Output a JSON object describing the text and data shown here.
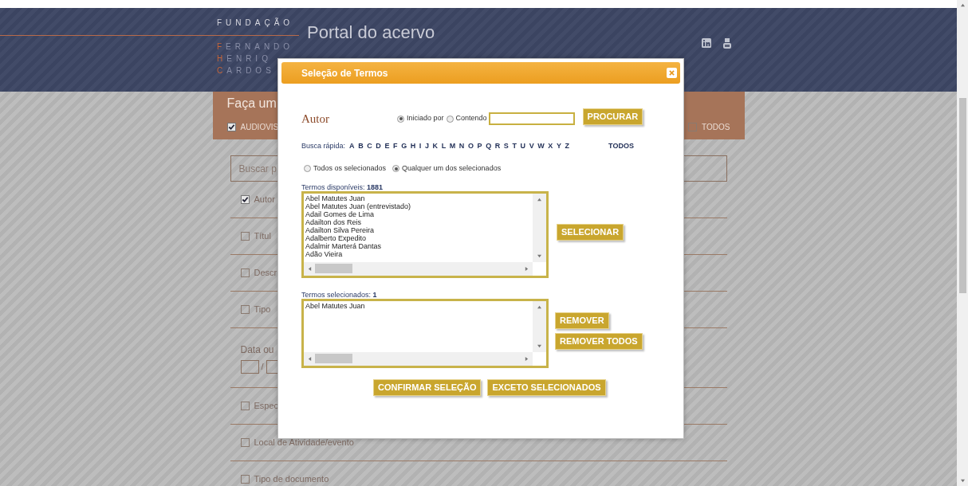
{
  "header": {
    "logo_top": "FUNDAÇÃO",
    "logo_names": [
      "FERNANDO",
      "HENRIQ",
      "CARDOS"
    ],
    "title": "Portal do acervo"
  },
  "search_panel": {
    "title": "Faça um",
    "filters": [
      {
        "label": "AUDIOVIS",
        "checked": true
      },
      {
        "label": "TODOS",
        "checked": false
      }
    ]
  },
  "search_field": {
    "placeholder": "Buscar p"
  },
  "fields": [
    {
      "kind": "checkbox",
      "label": "Autor",
      "checked": true
    },
    {
      "kind": "checkbox",
      "label": "Títul",
      "checked": false
    },
    {
      "kind": "checkbox",
      "label": "Descr",
      "checked": false
    },
    {
      "kind": "checkbox",
      "label": "Tipo",
      "checked": false
    },
    {
      "kind": "date",
      "label": "Data ou",
      "separator": "/"
    },
    {
      "kind": "checkbox",
      "label": "Espec",
      "checked": false
    },
    {
      "kind": "checkbox",
      "label": "Local de Atividade/evento",
      "checked": false
    },
    {
      "kind": "checkbox",
      "label": "Tipo de documento",
      "checked": false
    }
  ],
  "dialog": {
    "title": "Seleção de Termos",
    "field": "Autor",
    "search_modes": [
      {
        "label": "Iniciado por",
        "selected": true
      },
      {
        "label": "Contendo",
        "selected": false
      }
    ],
    "search_button": "PROCURAR",
    "quick_label": "Busca rápida:",
    "letters": [
      "A",
      "B",
      "C",
      "D",
      "E",
      "F",
      "G",
      "H",
      "I",
      "J",
      "K",
      "L",
      "M",
      "N",
      "O",
      "P",
      "Q",
      "R",
      "S",
      "T",
      "U",
      "V",
      "W",
      "X",
      "Y",
      "Z"
    ],
    "all_letters": "TODOS",
    "match_modes": [
      {
        "label": "Todos os selecionados",
        "selected": false
      },
      {
        "label": "Qualquer um dos selecionados",
        "selected": true
      }
    ],
    "available_label": "Termos disponíveis:",
    "available_count": "1881",
    "available": [
      "Abel Matutes Juan",
      "Abel Matutes Juan (entrevistado)",
      "Adail Gomes de Lima",
      "Adailton dos Reis",
      "Adailton Silva Pereira",
      "Adalberto Expedito",
      "Adalmir Marterá Dantas",
      "Adão Vieira"
    ],
    "select_button": "SELECIONAR",
    "selected_label": "Termos selecionados:",
    "selected_count": "1",
    "selected": [
      "Abel Matutes Juan"
    ],
    "remove_buttons": [
      "REMOVER",
      "REMOVER TODOS"
    ],
    "footer_buttons": [
      "CONFIRMAR SELEÇÃO",
      "EXCETO SELECIONADOS"
    ]
  }
}
